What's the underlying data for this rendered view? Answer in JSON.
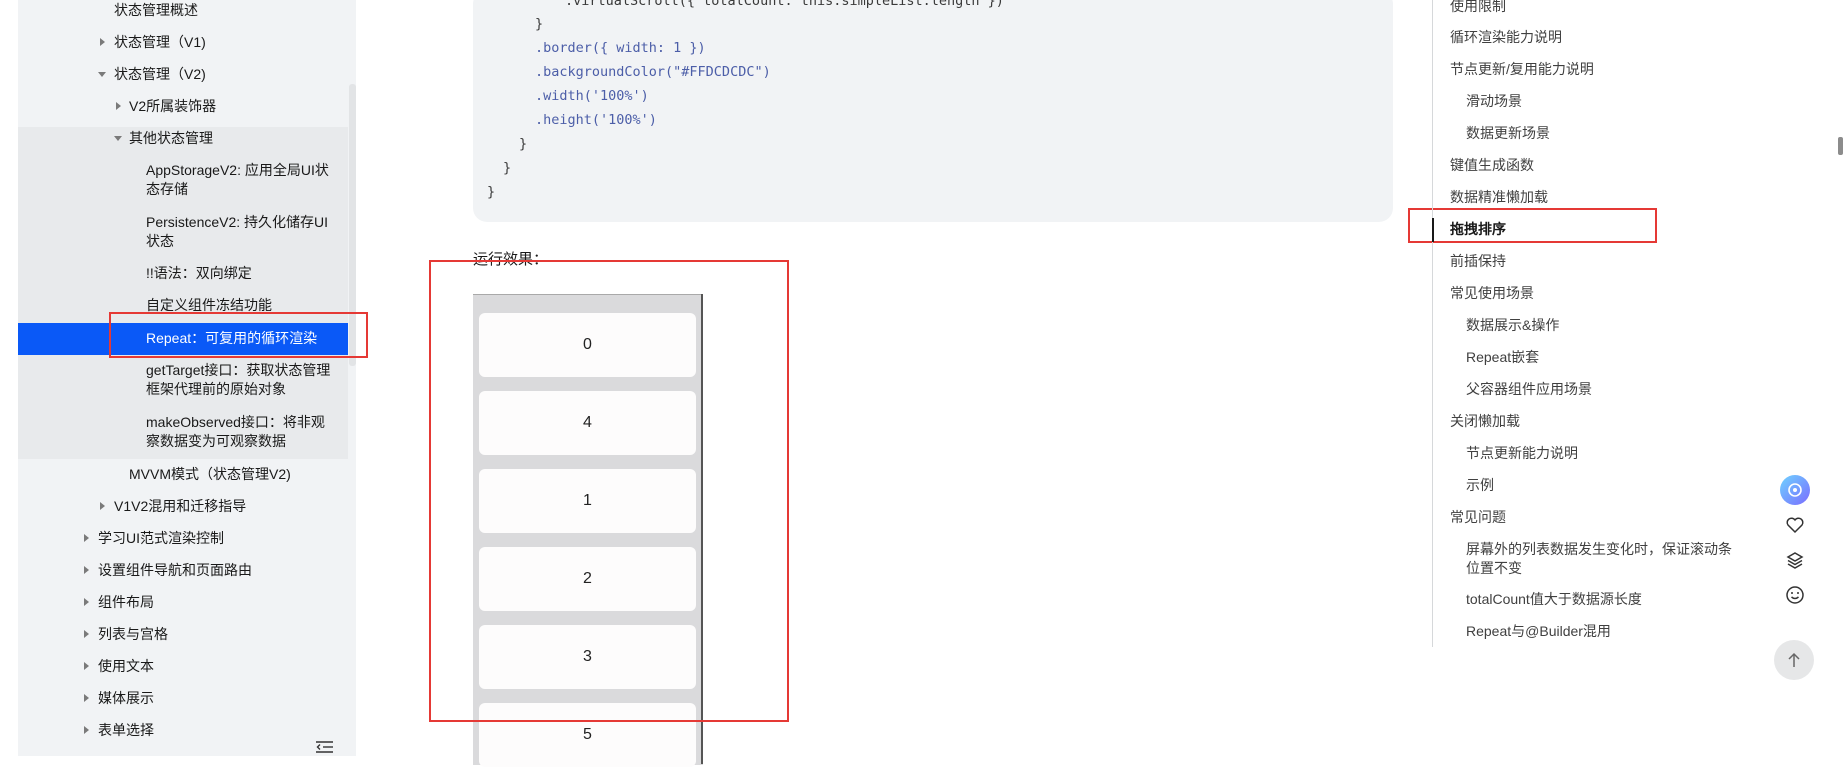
{
  "sidebar": {
    "items": [
      {
        "label": "状态管理概述"
      },
      {
        "label": "状态管理（V1)"
      },
      {
        "label": "状态管理（V2)"
      },
      {
        "label": "V2所属装饰器"
      },
      {
        "label": "其他状态管理"
      },
      {
        "label": "AppStorageV2: 应用全局UI状态存储"
      },
      {
        "label": "PersistenceV2: 持久化储存UI状态"
      },
      {
        "label": "!!语法：双向绑定"
      },
      {
        "label": "自定义组件冻结功能"
      },
      {
        "label": "Repeat：可复用的循环渲染"
      },
      {
        "label": "getTarget接口：获取状态管理框架代理前的原始对象"
      },
      {
        "label": "makeObserved接口：将非观察数据变为可观察数据"
      },
      {
        "label": "MVVM模式（状态管理V2)"
      },
      {
        "label": "V1V2混用和迁移指导"
      },
      {
        "label": "学习UI范式渲染控制"
      },
      {
        "label": "设置组件导航和页面路由"
      },
      {
        "label": "组件布局"
      },
      {
        "label": "列表与宫格"
      },
      {
        "label": "使用文本"
      },
      {
        "label": "媒体展示"
      },
      {
        "label": "表单选择"
      }
    ],
    "item5_lines": [
      "AppStorageV2: 应用全局UI状",
      "态存储"
    ],
    "item6_lines": [
      "PersistenceV2: 持久化储存UI",
      "状态"
    ],
    "item10_lines": [
      "getTarget接口：获取状态管理",
      "框架代理前的原始对象"
    ],
    "item11_lines": [
      "makeObserved接口：将非观",
      "察数据变为可观察数据"
    ]
  },
  "code": {
    "lines": [
      ".virtualScroll({ totalCount: this.simpleList.length })",
      "}",
      ".border({ width: 1 })",
      ".backgroundColor(\"#FFDCDCDC\")",
      ".width('100%')",
      ".height('100%')",
      "}",
      "}",
      "}"
    ]
  },
  "main": {
    "run_label": "运行效果：",
    "list_items": [
      "0",
      "4",
      "1",
      "2",
      "3",
      "5"
    ]
  },
  "toc": {
    "items": [
      {
        "label": "使用限制"
      },
      {
        "label": "循环渲染能力说明"
      },
      {
        "label": "节点更新/复用能力说明"
      },
      {
        "label": "滑动场景"
      },
      {
        "label": "数据更新场景"
      },
      {
        "label": "键值生成函数"
      },
      {
        "label": "数据精准懒加载"
      },
      {
        "label": "拖拽排序"
      },
      {
        "label": "前插保持"
      },
      {
        "label": "常见使用场景"
      },
      {
        "label": "数据展示&操作"
      },
      {
        "label": "Repeat嵌套"
      },
      {
        "label": "父容器组件应用场景"
      },
      {
        "label": "关闭懒加载"
      },
      {
        "label": "节点更新能力说明"
      },
      {
        "label": "示例"
      },
      {
        "label": "常见问题"
      },
      {
        "label": "屏幕外的列表数据发生变化时，保证滚动条位置不变"
      },
      {
        "label": "totalCount值大于数据源长度"
      },
      {
        "label": "Repeat与@Builder混用"
      }
    ],
    "item17_lines": [
      "屏幕外的列表数据发生变化时，保证滚动条",
      "位置不变"
    ]
  },
  "colors": {
    "accent": "#0a59f7",
    "annotation": "#e53935"
  },
  "icons": [
    "collapse-sidebar-icon",
    "assistant-icon",
    "favorite-icon",
    "layers-icon",
    "feedback-icon",
    "back-to-top-icon"
  ]
}
